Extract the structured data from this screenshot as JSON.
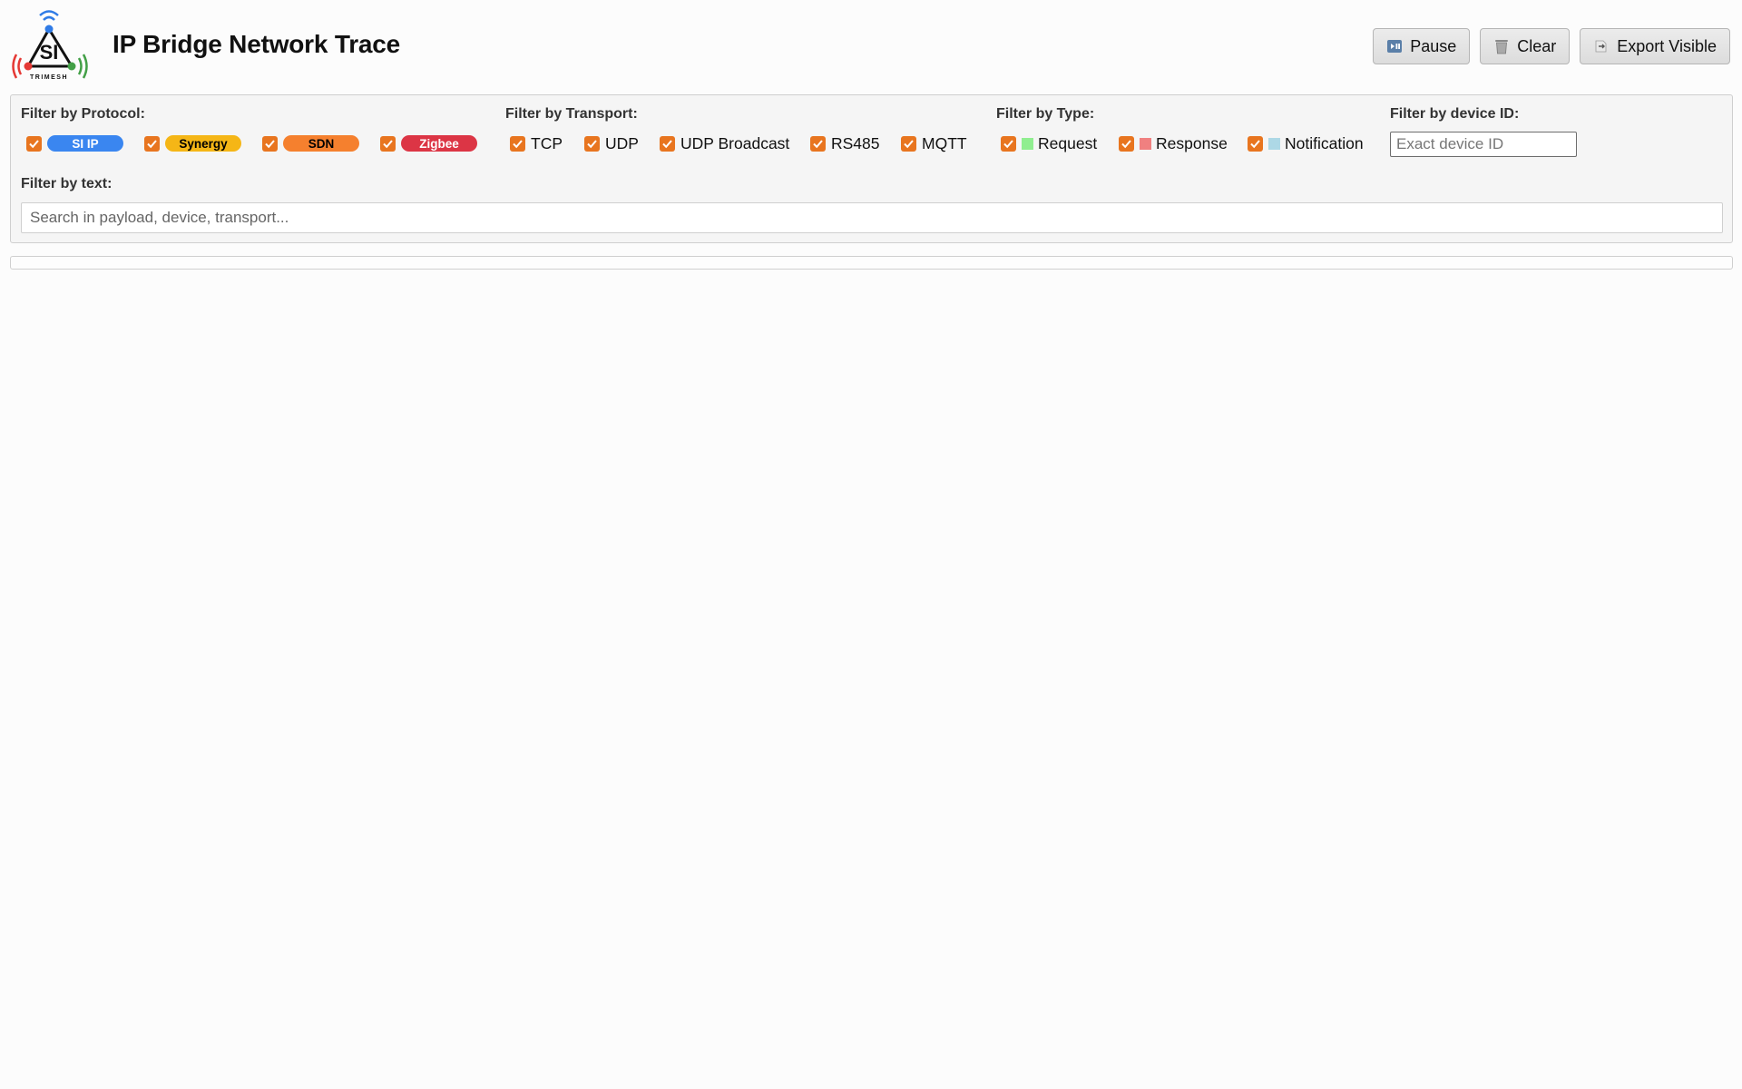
{
  "app": {
    "title": "IP Bridge Network Trace",
    "logo": {
      "mark_text": "SI",
      "wordmark": "TRIMESH"
    }
  },
  "toolbar": {
    "pause_label": "Pause",
    "clear_label": "Clear",
    "export_label": "Export Visible"
  },
  "filters": {
    "protocol": {
      "label": "Filter by Protocol:",
      "options": [
        {
          "label": "SI IP",
          "checked": true,
          "color": "#3a86f0",
          "text_color": "#ffffff"
        },
        {
          "label": "Synergy",
          "checked": true,
          "color": "#f5b616",
          "text_color": "#000000"
        },
        {
          "label": "SDN",
          "checked": true,
          "color": "#f5802e",
          "text_color": "#000000"
        },
        {
          "label": "Zigbee",
          "checked": true,
          "color": "#dc3545",
          "text_color": "#ffffff"
        }
      ]
    },
    "transport": {
      "label": "Filter by Transport:",
      "options": [
        {
          "label": "TCP",
          "checked": true
        },
        {
          "label": "UDP",
          "checked": true
        },
        {
          "label": "UDP Broadcast",
          "checked": true
        },
        {
          "label": "RS485",
          "checked": true
        },
        {
          "label": "MQTT",
          "checked": true
        }
      ]
    },
    "type": {
      "label": "Filter by Type:",
      "options": [
        {
          "label": "Request",
          "checked": true,
          "color": "#90ee90"
        },
        {
          "label": "Response",
          "checked": true,
          "color": "#f08080"
        },
        {
          "label": "Notification",
          "checked": true,
          "color": "#add8e6"
        }
      ]
    },
    "device": {
      "label": "Filter by device ID:",
      "value": "",
      "placeholder": "Exact device ID"
    },
    "text": {
      "label": "Filter by text:",
      "value": "",
      "placeholder": "Search in payload, device, transport..."
    }
  },
  "colors": {
    "checkbox": "#e8751f",
    "panel_background": "#f5f5f5"
  }
}
